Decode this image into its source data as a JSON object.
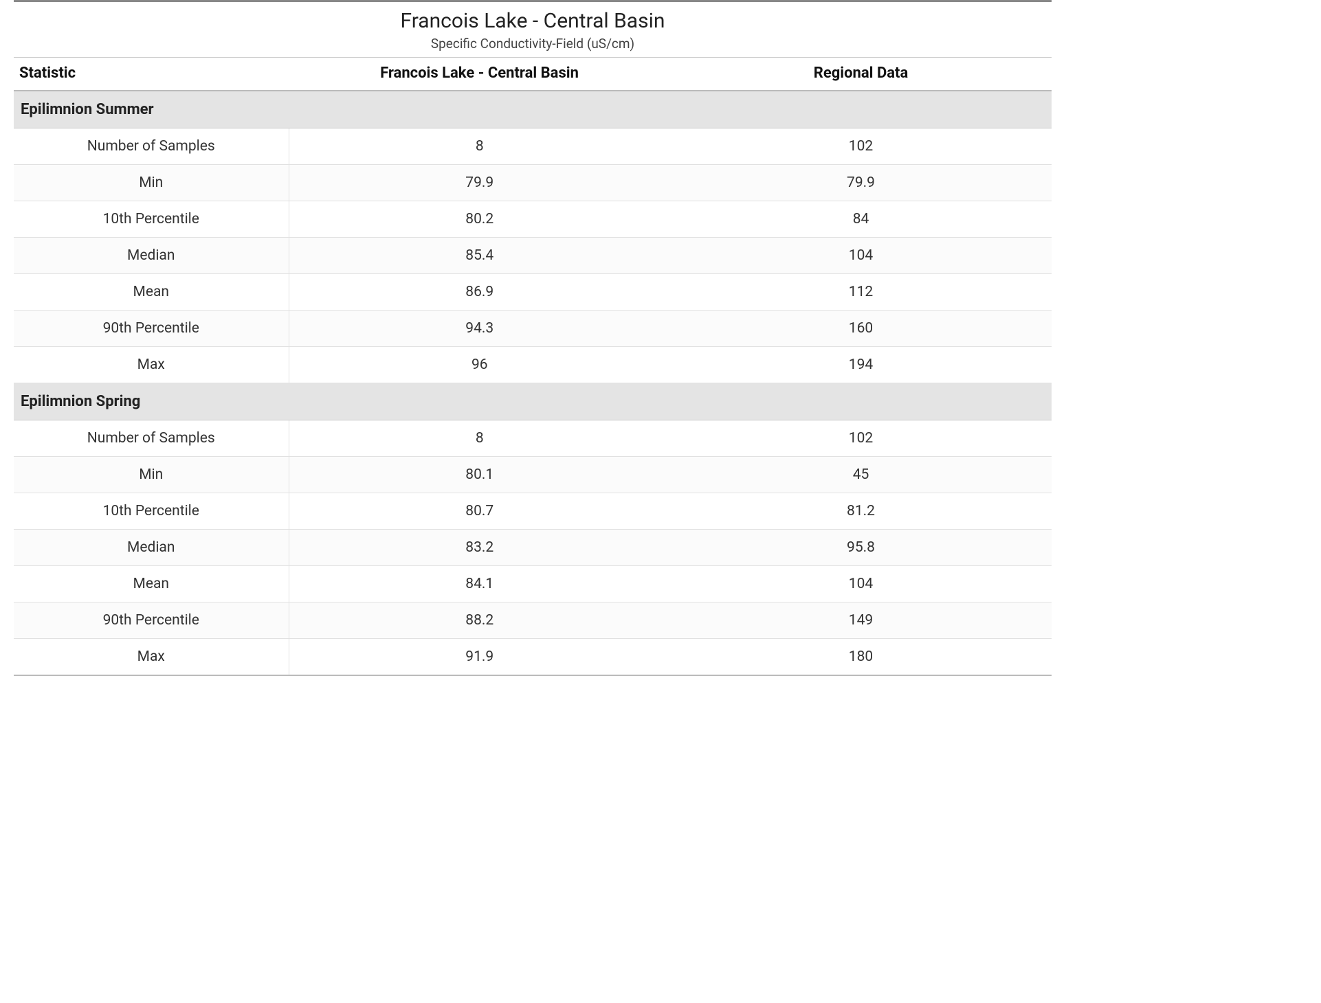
{
  "title": "Francois Lake - Central Basin",
  "subtitle": "Specific Conductivity-Field (uS/cm)",
  "columns": {
    "stat": "Statistic",
    "site": "Francois Lake - Central Basin",
    "region": "Regional Data"
  },
  "sections": [
    {
      "name": "Epilimnion Summer",
      "rows": [
        {
          "stat": "Number of Samples",
          "site": "8",
          "region": "102"
        },
        {
          "stat": "Min",
          "site": "79.9",
          "region": "79.9"
        },
        {
          "stat": "10th Percentile",
          "site": "80.2",
          "region": "84"
        },
        {
          "stat": "Median",
          "site": "85.4",
          "region": "104"
        },
        {
          "stat": "Mean",
          "site": "86.9",
          "region": "112"
        },
        {
          "stat": "90th Percentile",
          "site": "94.3",
          "region": "160"
        },
        {
          "stat": "Max",
          "site": "96",
          "region": "194"
        }
      ]
    },
    {
      "name": "Epilimnion Spring",
      "rows": [
        {
          "stat": "Number of Samples",
          "site": "8",
          "region": "102"
        },
        {
          "stat": "Min",
          "site": "80.1",
          "region": "45"
        },
        {
          "stat": "10th Percentile",
          "site": "80.7",
          "region": "81.2"
        },
        {
          "stat": "Median",
          "site": "83.2",
          "region": "95.8"
        },
        {
          "stat": "Mean",
          "site": "84.1",
          "region": "104"
        },
        {
          "stat": "90th Percentile",
          "site": "88.2",
          "region": "149"
        },
        {
          "stat": "Max",
          "site": "91.9",
          "region": "180"
        }
      ]
    }
  ]
}
